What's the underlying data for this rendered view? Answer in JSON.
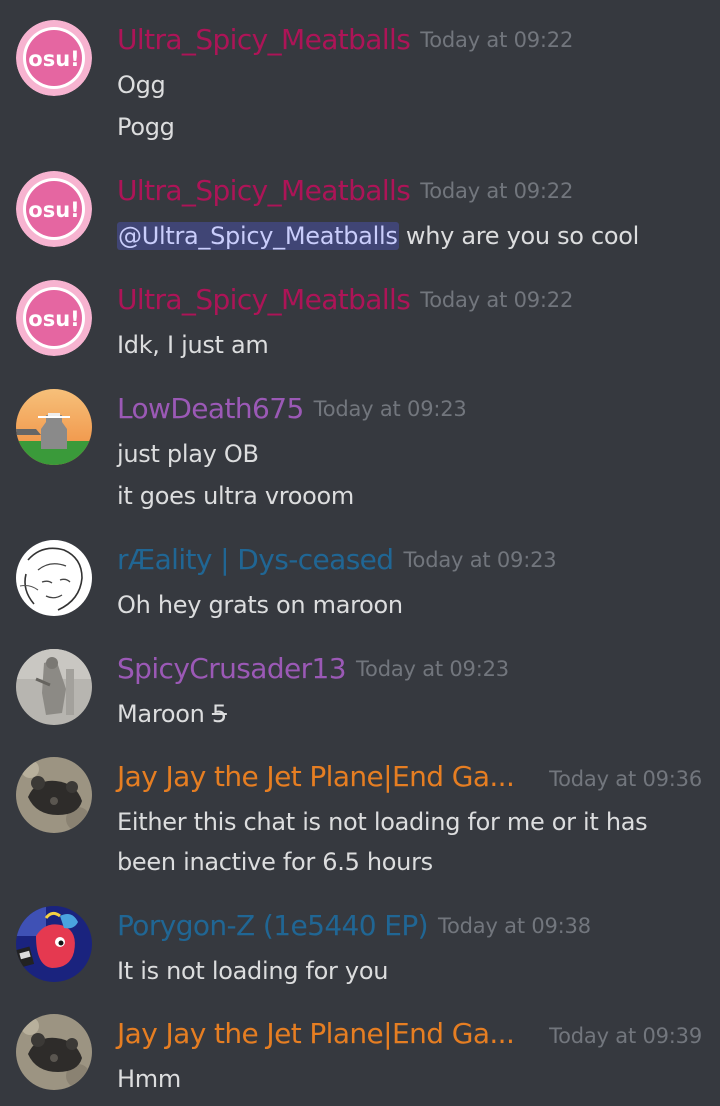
{
  "colors": {
    "background": "#36393f",
    "text": "#dcddde",
    "timestamp": "#72767d",
    "mention_bg": "#3d4270",
    "mention_text": "#c9cdfb"
  },
  "messages": [
    {
      "author": "Ultra_Spicy_Meatballs",
      "author_color": "#ad1457",
      "avatar": "osu-logo-avatar",
      "avatar_text": "osu!",
      "timestamp": "Today at 09:22",
      "lines": [
        "Ogg",
        "Pogg"
      ]
    },
    {
      "author": "Ultra_Spicy_Meatballs",
      "author_color": "#ad1457",
      "avatar": "osu-logo-avatar",
      "avatar_text": "osu!",
      "timestamp": "Today at 09:22",
      "mention": "@Ultra_Spicy_Meatballs",
      "lines": [
        " why are you so cool"
      ]
    },
    {
      "author": "Ultra_Spicy_Meatballs",
      "author_color": "#ad1457",
      "avatar": "osu-logo-avatar",
      "avatar_text": "osu!",
      "timestamp": "Today at 09:22",
      "lines": [
        "Idk, I just am"
      ]
    },
    {
      "author": "LowDeath675",
      "author_color": "#9b59b6",
      "avatar": "sunset-figure-avatar",
      "timestamp": "Today at 09:23",
      "lines": [
        "just play OB",
        "it goes ultra vrooom"
      ]
    },
    {
      "author": "rÆality | Dys-ceased",
      "author_color": "#206694",
      "avatar": "sketch-face-avatar",
      "timestamp": "Today at 09:23",
      "lines": [
        "Oh hey grats on maroon"
      ]
    },
    {
      "author": "SpicyCrusader13",
      "author_color": "#9b59b6",
      "avatar": "gray-photo-avatar",
      "timestamp": "Today at 09:23",
      "lines": [
        "Maroon "
      ],
      "strike": "5"
    },
    {
      "author": "Jay Jay the Jet Plane|End Ga...",
      "author_color": "#e67e22",
      "avatar": "rock-animal-avatar",
      "timestamp": "Today at 09:36",
      "lines": [
        "Either this chat is not loading for me or it has",
        "been inactive for 6.5 hours"
      ]
    },
    {
      "author": "Porygon-Z (1e5440 EP)",
      "author_color": "#206694",
      "avatar": "pony-avatar",
      "timestamp": "Today at 09:38",
      "lines": [
        "It is not loading for you"
      ]
    },
    {
      "author": "Jay Jay the Jet Plane|End Ga...",
      "author_color": "#e67e22",
      "avatar": "rock-animal-avatar",
      "timestamp": "Today at 09:39",
      "lines": [
        "Hmm"
      ]
    }
  ]
}
